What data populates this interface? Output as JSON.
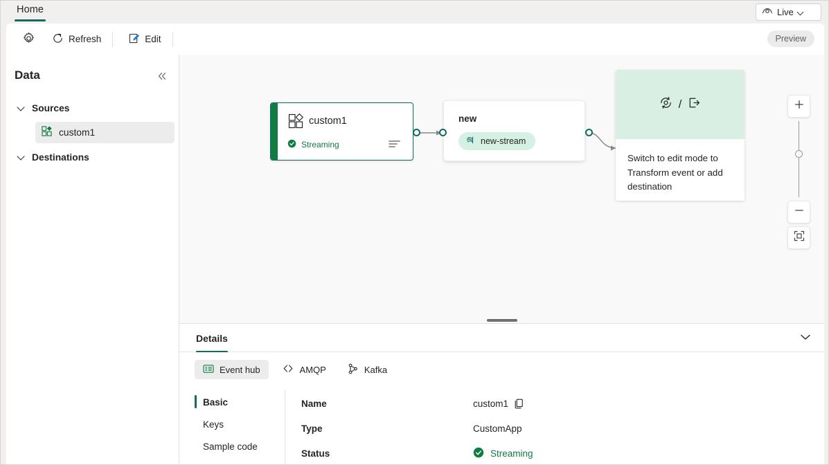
{
  "ribbon": {
    "tab_home": "Home",
    "live_label": "Live",
    "live_icon": "eye-icon",
    "live_chevron_icon": "chevron-down-icon"
  },
  "commandbar": {
    "settings_icon": "gear-icon",
    "refresh_label": "Refresh",
    "refresh_icon": "refresh-icon",
    "edit_label": "Edit",
    "edit_icon": "edit-pencil-icon",
    "preview_label": "Preview"
  },
  "sidebar": {
    "title": "Data",
    "collapse_icon": "double-chevron-left-icon",
    "groups": [
      {
        "label": "Sources",
        "chevron_icon": "chevron-down-icon",
        "items": [
          {
            "label": "custom1",
            "icon": "custom-app-icon",
            "selected": true
          }
        ]
      },
      {
        "label": "Destinations",
        "chevron_icon": "chevron-down-icon",
        "items": []
      }
    ]
  },
  "canvas": {
    "nodes": [
      {
        "id": "custom1",
        "title": "custom1",
        "icon": "custom-app-icon",
        "status": "Streaming",
        "status_icon": "check-circle-icon",
        "menu_icon": "lines-icon",
        "accent_color": "#107c41",
        "border_color": "#0f6b5e"
      },
      {
        "id": "new",
        "title": "new",
        "stream_pill_label": "new-stream",
        "stream_pill_icon": "stream-icon",
        "stream_pill_color": "#d6f0e3"
      },
      {
        "id": "hint",
        "hero_icons": [
          "transform-event-icon",
          "add-destination-icon"
        ],
        "hero_separator": "/",
        "text": "Switch to edit mode to Transform event or add destination",
        "hero_color": "#d9efe3"
      }
    ],
    "zoom_controls": {
      "zoom_in_icon": "plus-icon",
      "zoom_out_icon": "minus-icon",
      "fit_to_screen_icon": "fit-to-screen-icon",
      "slider_handle_icon": "slider-handle-icon"
    },
    "resize_handle_icon": "drag-handle-icon"
  },
  "details": {
    "tab_label": "Details",
    "collapse_icon": "chevron-down-icon",
    "protocol_tabs": [
      {
        "label": "Event hub",
        "icon": "event-hub-icon",
        "active": true
      },
      {
        "label": "AMQP",
        "icon": "amqp-icon",
        "active": false
      },
      {
        "label": "Kafka",
        "icon": "kafka-icon",
        "active": false
      }
    ],
    "subnav": [
      {
        "label": "Basic",
        "active": true
      },
      {
        "label": "Keys",
        "active": false
      },
      {
        "label": "Sample code",
        "active": false
      }
    ],
    "properties": [
      {
        "key": "Name",
        "value": "custom1",
        "copy_icon": "copy-icon"
      },
      {
        "key": "Type",
        "value": "CustomApp"
      },
      {
        "key": "Status",
        "value": "Streaming",
        "icon": "check-circle-icon",
        "color": "#107c41"
      }
    ]
  }
}
